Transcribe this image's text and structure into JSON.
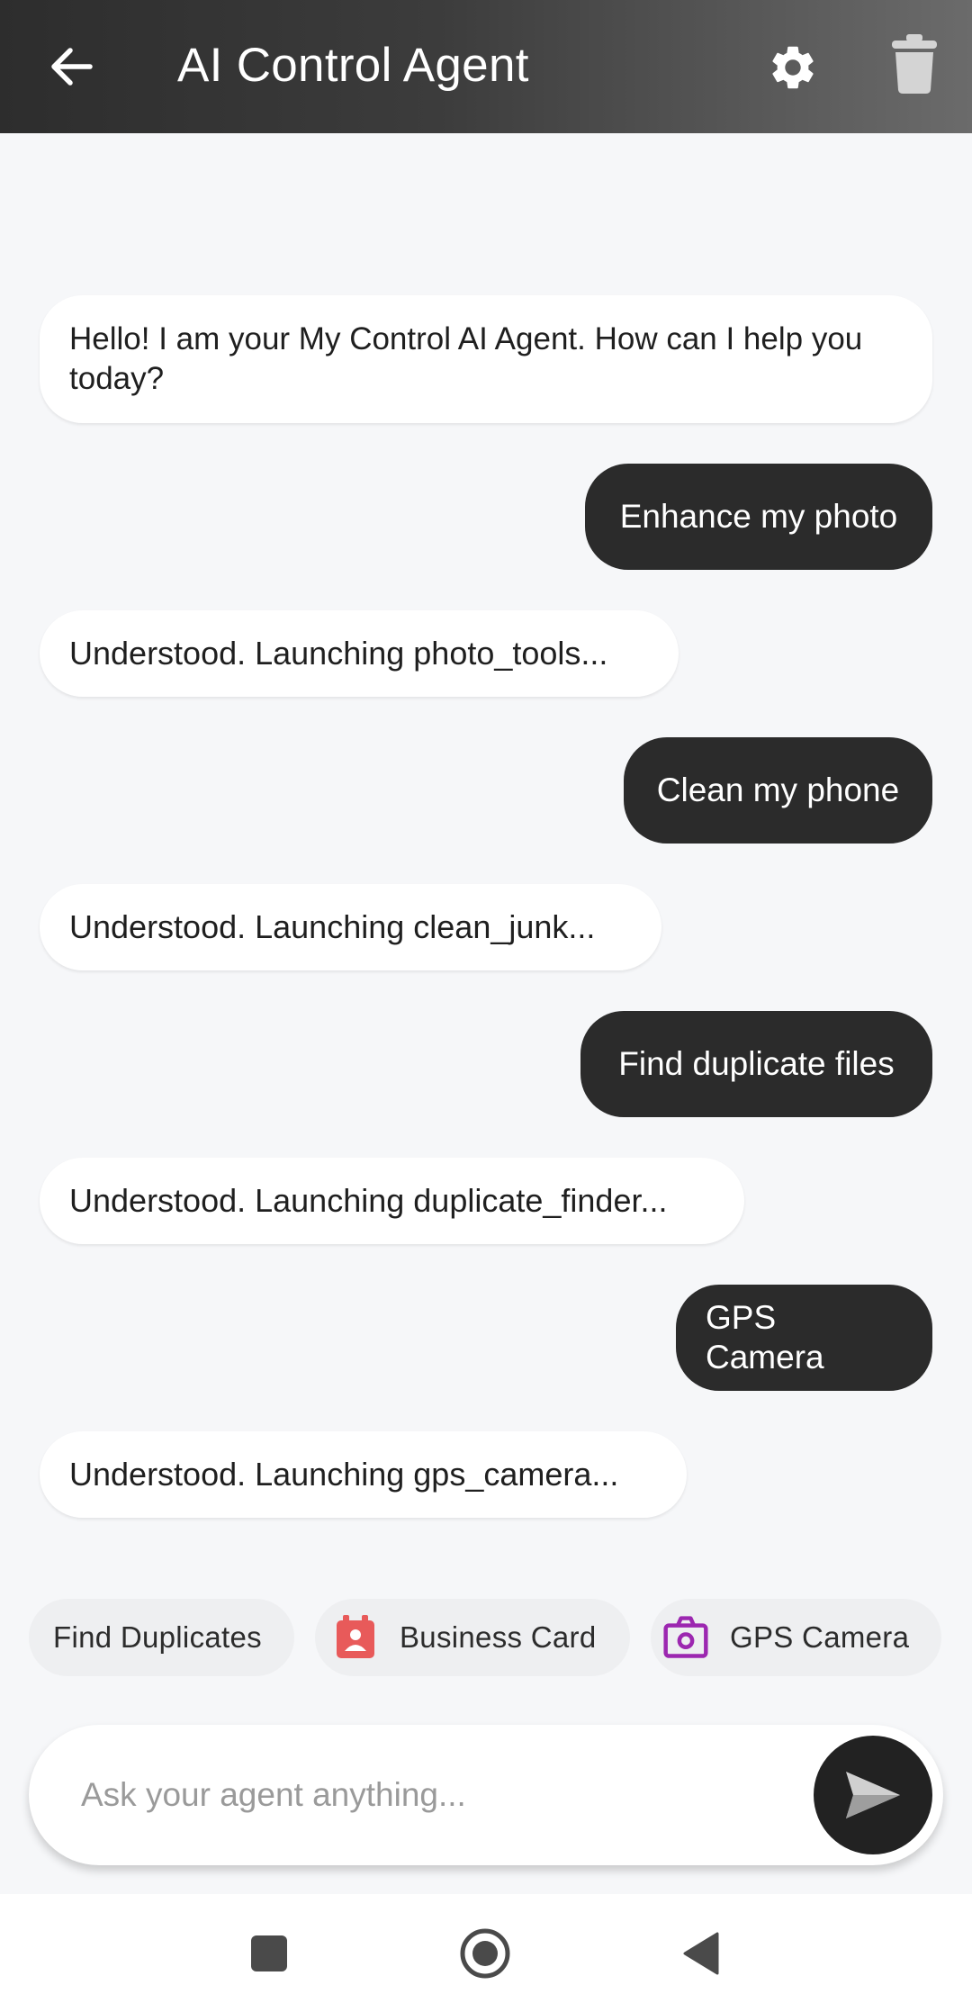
{
  "app_bar": {
    "title": "AI Control Agent",
    "back_icon": "arrow-left-icon",
    "settings_icon": "gear-icon",
    "clear_icon": "trash-icon"
  },
  "messages": [
    {
      "role": "agent",
      "text": "Hello! I am your My Control AI Agent. How can I help you today?"
    },
    {
      "role": "user",
      "text": "Enhance my photo"
    },
    {
      "role": "agent",
      "text": "Understood. Launching photo_tools..."
    },
    {
      "role": "user",
      "text": "Clean my phone"
    },
    {
      "role": "agent",
      "text": "Understood. Launching clean_junk..."
    },
    {
      "role": "user",
      "text": "Find duplicate files"
    },
    {
      "role": "agent",
      "text": "Understood. Launching duplicate_finder..."
    },
    {
      "role": "user",
      "text": "GPS Camera"
    },
    {
      "role": "agent",
      "text": "Understood. Launching gps_camera..."
    }
  ],
  "quick_actions": [
    {
      "label": "Find Duplicates",
      "icon": null
    },
    {
      "label": "Business Card",
      "icon": "business-card-icon"
    },
    {
      "label": "GPS Camera",
      "icon": "camera-icon"
    }
  ],
  "input": {
    "placeholder": "Ask your agent anything...",
    "value": "",
    "send_icon": "send-icon"
  },
  "nav": {
    "recents_icon": "square-icon",
    "home_icon": "circle-icon",
    "back_icon": "triangle-back-icon"
  },
  "colors": {
    "user_bubble": "#2b2b2b",
    "agent_bubble": "#ffffff",
    "background": "#f6f7f9",
    "business_card_icon": "#e85a5a",
    "camera_icon": "#9c27b0"
  }
}
